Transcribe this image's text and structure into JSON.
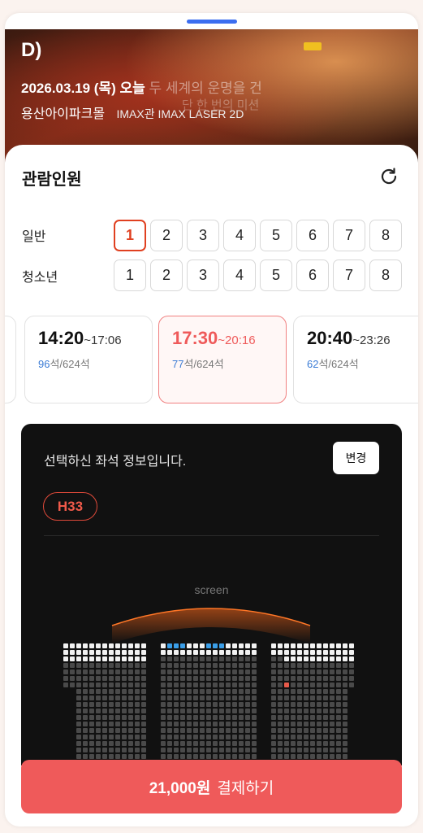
{
  "movie": {
    "title": "D)",
    "date": "2026.03.19 (목) 오늘",
    "tagline": "두 세계의 운명을 건",
    "tagline2": "단 한 번의 미션",
    "theater": "용산아이파크몰",
    "hall": "IMAX관 IMAX LASER 2D"
  },
  "audience": {
    "title": "관람인원",
    "refresh_icon": "refresh-icon",
    "rows": [
      {
        "label": "일반",
        "selected": 1,
        "options": [
          "1",
          "2",
          "3",
          "4",
          "5",
          "6",
          "7",
          "8"
        ]
      },
      {
        "label": "청소년",
        "selected": null,
        "options": [
          "1",
          "2",
          "3",
          "4",
          "5",
          "6",
          "7",
          "8"
        ]
      }
    ]
  },
  "showtimes": [
    {
      "start": "14:20",
      "end": "~17:06",
      "available": "96",
      "total": "석/624석"
    },
    {
      "start": "17:30",
      "end": "~20:16",
      "available": "77",
      "total": "석/624석"
    },
    {
      "start": "20:40",
      "end": "~23:26",
      "available": "62",
      "total": "석/624석"
    }
  ],
  "seat_panel": {
    "info_text": "선택하신 좌석 정보입니다.",
    "change_label": "변경",
    "selected_seat": "H33",
    "screen_label": "screen"
  },
  "payment": {
    "amount": "21,000원",
    "label": "결제하기"
  },
  "colors": {
    "accent": "#ef5a5a",
    "available_count": "#3a7bd5",
    "seat_selected": "#e85a4a",
    "seat_highlight": "#3a9ee8"
  }
}
